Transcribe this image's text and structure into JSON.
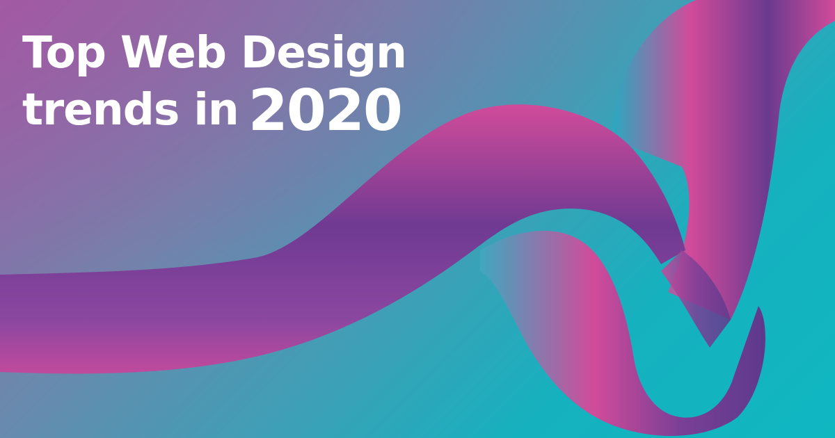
{
  "headline": {
    "line1": "Top Web Design",
    "line2": "trends in",
    "year": "2020"
  },
  "colors": {
    "text": "#ffffff",
    "background_teal": "#0fb7c1",
    "background_violet": "#9a5fa6",
    "ribbon_dark": "#5f3a8f",
    "ribbon_mid": "#8b47a0",
    "ribbon_pink": "#d14b9a"
  }
}
